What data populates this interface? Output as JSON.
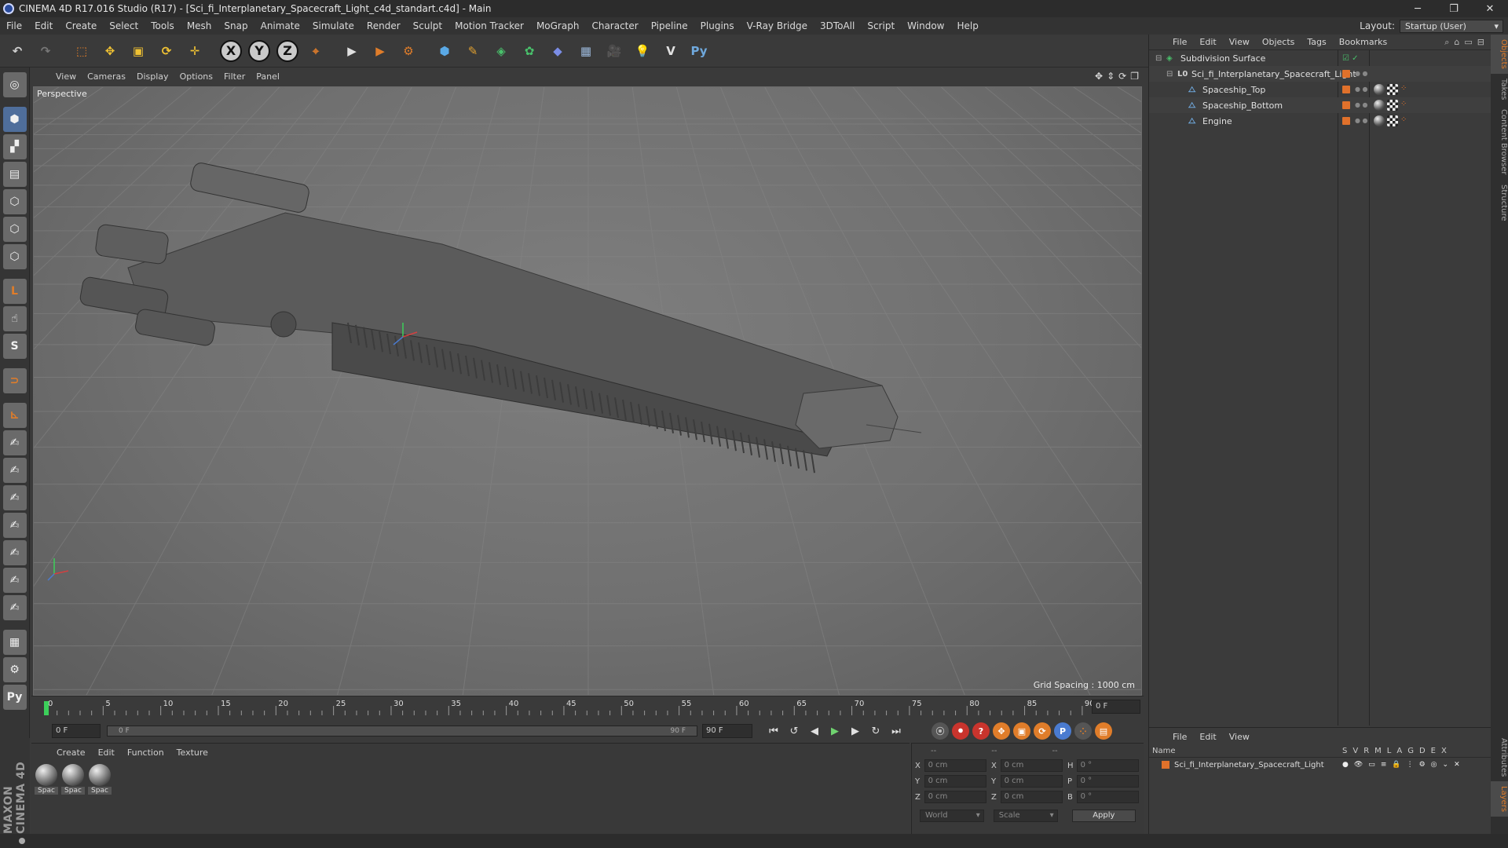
{
  "window": {
    "title": "CINEMA 4D R17.016 Studio (R17) - [Sci_fi_Interplanetary_Spacecraft_Light_c4d_standart.c4d] - Main",
    "minimize": "─",
    "restore": "❐",
    "close": "✕"
  },
  "menu": {
    "items": [
      "File",
      "Edit",
      "Create",
      "Select",
      "Tools",
      "Mesh",
      "Snap",
      "Animate",
      "Simulate",
      "Render",
      "Sculpt",
      "Motion Tracker",
      "MoGraph",
      "Character",
      "Pipeline",
      "Plugins",
      "V-Ray Bridge",
      "3DToAll",
      "Script",
      "Window",
      "Help"
    ],
    "layout_label": "Layout:",
    "layout_value": "Startup (User)"
  },
  "toolbar": {
    "buttons": [
      {
        "name": "undo-icon",
        "glyph": "↶",
        "color": "#d0d0d0"
      },
      {
        "name": "redo-icon",
        "glyph": "↷",
        "color": "#777777"
      },
      {
        "name": "sep"
      },
      {
        "name": "live-select-icon",
        "glyph": "⬚",
        "color": "#e07d2a"
      },
      {
        "name": "move-icon",
        "glyph": "✥",
        "color": "#f0c233"
      },
      {
        "name": "scale-icon",
        "glyph": "▣",
        "color": "#f0c233"
      },
      {
        "name": "rotate-icon",
        "glyph": "⟳",
        "color": "#f0c233"
      },
      {
        "name": "transform-icon",
        "glyph": "✛",
        "color": "#f0c233"
      },
      {
        "name": "sep"
      },
      {
        "name": "axis-x-icon",
        "axis": "X"
      },
      {
        "name": "axis-y-icon",
        "axis": "Y"
      },
      {
        "name": "axis-z-icon",
        "axis": "Z"
      },
      {
        "name": "coordinate-system-icon",
        "glyph": "⌖",
        "color": "#e07d2a"
      },
      {
        "name": "sep"
      },
      {
        "name": "render-view-icon",
        "glyph": "▶",
        "color": "#e0e0e0"
      },
      {
        "name": "render-picture-viewer-icon",
        "glyph": "▶",
        "color": "#e07d2a"
      },
      {
        "name": "render-settings-icon",
        "glyph": "⚙",
        "color": "#e07d2a"
      },
      {
        "name": "sep"
      },
      {
        "name": "cube-icon",
        "glyph": "⬢",
        "color": "#5aa9e6"
      },
      {
        "name": "spline-pen-icon",
        "glyph": "✎",
        "color": "#e0a030"
      },
      {
        "name": "subdivision-surface-icon",
        "glyph": "◈",
        "color": "#49c16b"
      },
      {
        "name": "mograph-cloner-icon",
        "glyph": "✿",
        "color": "#49c16b"
      },
      {
        "name": "deformer-icon",
        "glyph": "◆",
        "color": "#7b8de6"
      },
      {
        "name": "floor-icon",
        "glyph": "▦",
        "color": "#9ab6d8"
      },
      {
        "name": "camera-icon",
        "glyph": "🎥",
        "color": "#e0e0e0"
      },
      {
        "name": "light-icon",
        "glyph": "💡",
        "color": "#e0e0e0"
      },
      {
        "name": "vray-icon",
        "glyph": "V",
        "color": "#e0e0e0"
      },
      {
        "name": "python-icon",
        "glyph": "Py",
        "color": "#6fa8dc"
      }
    ]
  },
  "left_tools": [
    {
      "name": "make-editable-icon",
      "glyph": "◎"
    },
    {
      "name": "sep"
    },
    {
      "name": "model-mode-icon",
      "glyph": "⬢",
      "active": true
    },
    {
      "name": "texture-mode-icon",
      "glyph": "▞"
    },
    {
      "name": "workplane-icon",
      "glyph": "▤"
    },
    {
      "name": "points-mode-icon",
      "glyph": "⬡"
    },
    {
      "name": "edges-mode-icon",
      "glyph": "⬡"
    },
    {
      "name": "polygons-mode-icon",
      "glyph": "⬡"
    },
    {
      "name": "sep"
    },
    {
      "name": "axis-mode-icon",
      "glyph": "L"
    },
    {
      "name": "tweak-mode-icon",
      "glyph": "☝"
    },
    {
      "name": "solo-icon",
      "glyph": "S"
    },
    {
      "name": "sep"
    },
    {
      "name": "snap-icon",
      "glyph": "⊃"
    },
    {
      "name": "sep"
    },
    {
      "name": "workplane-axis-icon",
      "glyph": "⊾"
    },
    {
      "name": "brush-tool-icon",
      "glyph": "✍"
    },
    {
      "name": "pin-tool-icon",
      "glyph": "✍"
    },
    {
      "name": "knife-tool-icon",
      "glyph": "✍"
    },
    {
      "name": "paint-tool-icon",
      "glyph": "✍"
    },
    {
      "name": "magnet-tool-icon",
      "glyph": "✍"
    },
    {
      "name": "sculpt-grab-icon",
      "glyph": "✍"
    },
    {
      "name": "sculpt-smooth-icon",
      "glyph": "✍"
    },
    {
      "name": "sep"
    },
    {
      "name": "lock-workplane-icon",
      "glyph": "▦"
    },
    {
      "name": "gear-workplane-icon",
      "glyph": "⚙"
    },
    {
      "name": "python-script-icon",
      "glyph": "Py"
    }
  ],
  "viewport": {
    "menu": [
      "View",
      "Cameras",
      "Display",
      "Options",
      "Filter",
      "Panel"
    ],
    "label": "Perspective",
    "grid_spacing": "Grid Spacing : 1000 cm"
  },
  "timeline": {
    "ticks": [
      "0",
      "5",
      "10",
      "15",
      "20",
      "25",
      "30",
      "35",
      "40",
      "45",
      "50",
      "55",
      "60",
      "65",
      "70",
      "75",
      "80",
      "85",
      "90"
    ],
    "current_frame": "0 F"
  },
  "transport": {
    "start_field": "0 F",
    "range_start": "0 F",
    "range_end": "90 F",
    "end_field": "90 F",
    "buttons": [
      {
        "name": "goto-start-icon",
        "glyph": "⏮"
      },
      {
        "name": "prev-key-icon",
        "glyph": "↺"
      },
      {
        "name": "prev-frame-icon",
        "glyph": "◀"
      },
      {
        "name": "play-icon",
        "glyph": "▶"
      },
      {
        "name": "next-frame-icon",
        "glyph": "▶"
      },
      {
        "name": "next-key-icon",
        "glyph": "↻"
      },
      {
        "name": "goto-end-icon",
        "glyph": "⏭"
      }
    ],
    "record_buttons": [
      {
        "name": "record-keys-icon",
        "glyph": "⦿",
        "bg": "#555555",
        "fg": "#bbbbbb"
      },
      {
        "name": "autokey-icon",
        "glyph": "⏺",
        "bg": "#c9342d",
        "fg": "#ffffff"
      },
      {
        "name": "keyframe-selection-icon",
        "glyph": "?",
        "bg": "#c9342d",
        "fg": "#ffffff"
      },
      {
        "name": "key-position-icon",
        "glyph": "✥",
        "bg": "#e07d2a",
        "fg": "#ffffff"
      },
      {
        "name": "key-scale-icon",
        "glyph": "▣",
        "bg": "#e07d2a",
        "fg": "#ffffff"
      },
      {
        "name": "key-rotation-icon",
        "glyph": "⟳",
        "bg": "#e07d2a",
        "fg": "#ffffff"
      },
      {
        "name": "key-param-icon",
        "glyph": "P",
        "bg": "#4a7bd0",
        "fg": "#ffffff"
      },
      {
        "name": "key-pla-icon",
        "glyph": "⁘",
        "bg": "#555555",
        "fg": "#e07d2a"
      },
      {
        "name": "timeline-icon",
        "glyph": "▤",
        "bg": "#e07d2a",
        "fg": "#ffffff"
      }
    ]
  },
  "materials": {
    "menu": [
      "Create",
      "Edit",
      "Function",
      "Texture"
    ],
    "items": [
      {
        "label": "Spac"
      },
      {
        "label": "Spac"
      },
      {
        "label": "Spac"
      }
    ]
  },
  "coords": {
    "headers": [
      "--",
      "--",
      "--"
    ],
    "rows": [
      {
        "a": "X",
        "av": "0 cm",
        "b": "X",
        "bv": "0 cm",
        "c": "H",
        "cv": "0 °"
      },
      {
        "a": "Y",
        "av": "0 cm",
        "b": "Y",
        "bv": "0 cm",
        "c": "P",
        "cv": "0 °"
      },
      {
        "a": "Z",
        "av": "0 cm",
        "b": "Z",
        "bv": "0 cm",
        "c": "B",
        "cv": "0 °"
      }
    ],
    "mode": "World",
    "type": "Scale",
    "apply": "Apply"
  },
  "brand": "MAXON CINEMA 4D",
  "objects": {
    "menu": [
      "File",
      "Edit",
      "View",
      "Objects",
      "Tags",
      "Bookmarks"
    ],
    "tree": [
      {
        "name": "Subdivision Surface",
        "indent": 0,
        "icon": "◈",
        "icon_color": "#49c16b",
        "dot": false,
        "tags": false
      },
      {
        "name": "Sci_fi_Interplanetary_Spacecraft_Light",
        "indent": 1,
        "icon": "L0",
        "icon_color": "#d0d0d0",
        "dot": true,
        "tags": false
      },
      {
        "name": "Spaceship_Top",
        "indent": 2,
        "icon": "⧍",
        "icon_color": "#6fa8dc",
        "dot": true,
        "tags": true
      },
      {
        "name": "Spaceship_Bottom",
        "indent": 2,
        "icon": "⧍",
        "icon_color": "#6fa8dc",
        "dot": true,
        "tags": true
      },
      {
        "name": "Engine",
        "indent": 2,
        "icon": "⧍",
        "icon_color": "#6fa8dc",
        "dot": true,
        "tags": true
      }
    ]
  },
  "layers": {
    "menu": [
      "File",
      "Edit",
      "View"
    ],
    "header_name": "Name",
    "cols": [
      "S",
      "V",
      "R",
      "M",
      "L",
      "A",
      "G",
      "D",
      "E",
      "X"
    ],
    "row_name": "Sci_fi_Interplanetary_Spacecraft_Light"
  },
  "side_tabs": [
    {
      "label": "Objects",
      "active": true
    },
    {
      "label": "Takes",
      "active": false
    },
    {
      "label": "Content Browser",
      "active": false
    },
    {
      "label": "Structure",
      "active": false
    }
  ],
  "side_tabs_bottom": [
    {
      "label": "Attributes",
      "active": false
    },
    {
      "label": "Layers",
      "active": true
    }
  ],
  "colors": {
    "accent": "#e07d2a",
    "play": "#6fd36f",
    "timeline_marker": "#3ccf5a"
  }
}
